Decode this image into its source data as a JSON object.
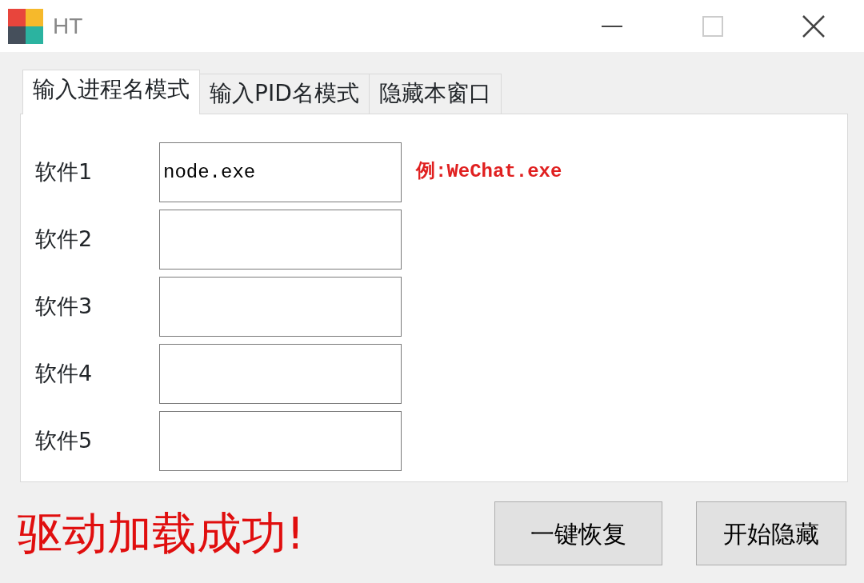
{
  "window": {
    "title": "HT",
    "controls": [
      {
        "kind": "minimize",
        "disabled": false
      },
      {
        "kind": "maximize",
        "disabled": true
      },
      {
        "kind": "close",
        "disabled": false
      }
    ]
  },
  "tabs": [
    {
      "label": "输入进程名模式",
      "selected": true
    },
    {
      "label": "输入PID名模式",
      "selected": false
    },
    {
      "label": "隐藏本窗口",
      "selected": false
    }
  ],
  "fields": [
    {
      "label": "软件1",
      "value": "node.exe",
      "hint": "例:WeChat.exe"
    },
    {
      "label": "软件2"
    },
    {
      "label": "软件3"
    },
    {
      "label": "软件4"
    },
    {
      "label": "软件5"
    }
  ],
  "status": "驱动加载成功!",
  "buttons": [
    "一键恢复",
    "开始隐藏"
  ]
}
